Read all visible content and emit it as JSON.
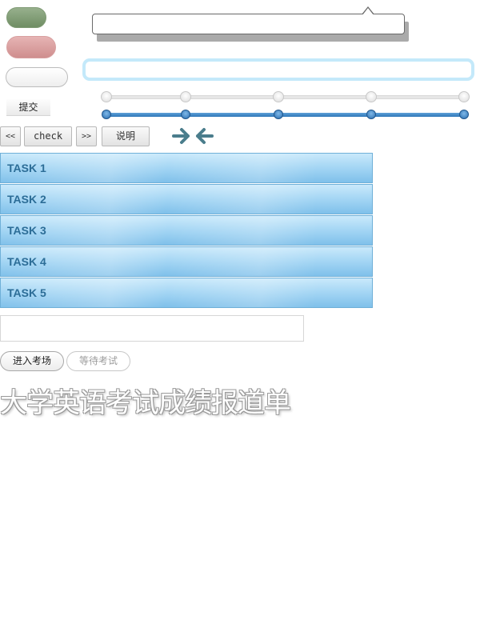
{
  "left_buttons": {
    "submit_label": "提交"
  },
  "tooltip": {
    "text": ""
  },
  "glow_input": {
    "value": ""
  },
  "slider": {
    "steps": 5,
    "blue_level": 1.0
  },
  "nav": {
    "prev_label": "<<",
    "check_label": "check",
    "next_label": ">>",
    "desc_label": "说明",
    "arrow_color": "#4a7d8c"
  },
  "tasks": [
    {
      "label": "TASK 1"
    },
    {
      "label": "TASK 2"
    },
    {
      "label": "TASK 3"
    },
    {
      "label": "TASK 4"
    },
    {
      "label": "TASK 5"
    }
  ],
  "plain_input": {
    "value": ""
  },
  "exam": {
    "enter_label": "进入考场",
    "wait_label": "等待考试"
  },
  "heading": {
    "title": "大学英语考试成绩报道单"
  },
  "colors": {
    "green_pill": "#7f9a74",
    "red_pill": "#d8a0a0",
    "slider_blue": "#2f77b8",
    "task_blue": "#9fd3f3"
  }
}
